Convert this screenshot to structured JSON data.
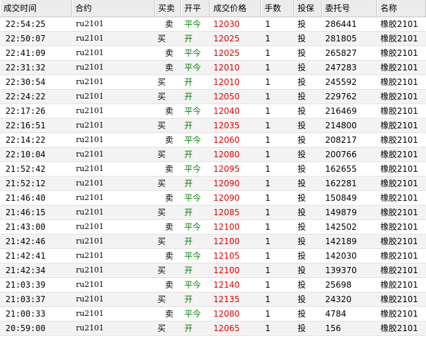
{
  "columns": {
    "time": "成交时间",
    "contract": "合约",
    "direction": "买卖",
    "open_close": "开平",
    "price": "成交价格",
    "quantity": "手数",
    "hedge": "投保",
    "order_no": "委托号",
    "name": "名称"
  },
  "trades": [
    {
      "time": "22:54:25",
      "contract": "ru2101",
      "direction": "卖",
      "open_close": "平今",
      "price": "12030",
      "quantity": "1",
      "hedge": "投",
      "order_no": "286441",
      "name": "橡胶2101"
    },
    {
      "time": "22:50:07",
      "contract": "ru2101",
      "direction": "买",
      "open_close": "开",
      "price": "12025",
      "quantity": "1",
      "hedge": "投",
      "order_no": "281805",
      "name": "橡胶2101"
    },
    {
      "time": "22:41:09",
      "contract": "ru2101",
      "direction": "卖",
      "open_close": "平今",
      "price": "12025",
      "quantity": "1",
      "hedge": "投",
      "order_no": "265827",
      "name": "橡胶2101"
    },
    {
      "time": "22:31:32",
      "contract": "ru2101",
      "direction": "卖",
      "open_close": "平今",
      "price": "12010",
      "quantity": "1",
      "hedge": "投",
      "order_no": "247283",
      "name": "橡胶2101"
    },
    {
      "time": "22:30:54",
      "contract": "ru2101",
      "direction": "买",
      "open_close": "开",
      "price": "12010",
      "quantity": "1",
      "hedge": "投",
      "order_no": "245592",
      "name": "橡胶2101"
    },
    {
      "time": "22:24:22",
      "contract": "ru2101",
      "direction": "买",
      "open_close": "开",
      "price": "12050",
      "quantity": "1",
      "hedge": "投",
      "order_no": "229762",
      "name": "橡胶2101"
    },
    {
      "time": "22:17:26",
      "contract": "ru2101",
      "direction": "卖",
      "open_close": "平今",
      "price": "12040",
      "quantity": "1",
      "hedge": "投",
      "order_no": "216469",
      "name": "橡胶2101"
    },
    {
      "time": "22:16:51",
      "contract": "ru2101",
      "direction": "买",
      "open_close": "开",
      "price": "12035",
      "quantity": "1",
      "hedge": "投",
      "order_no": "214800",
      "name": "橡胶2101"
    },
    {
      "time": "22:14:22",
      "contract": "ru2101",
      "direction": "卖",
      "open_close": "平今",
      "price": "12060",
      "quantity": "1",
      "hedge": "投",
      "order_no": "208217",
      "name": "橡胶2101"
    },
    {
      "time": "22:10:04",
      "contract": "ru2101",
      "direction": "买",
      "open_close": "开",
      "price": "12080",
      "quantity": "1",
      "hedge": "投",
      "order_no": "200766",
      "name": "橡胶2101"
    },
    {
      "time": "21:52:42",
      "contract": "ru2101",
      "direction": "卖",
      "open_close": "平今",
      "price": "12095",
      "quantity": "1",
      "hedge": "投",
      "order_no": "162655",
      "name": "橡胶2101"
    },
    {
      "time": "21:52:12",
      "contract": "ru2101",
      "direction": "买",
      "open_close": "开",
      "price": "12090",
      "quantity": "1",
      "hedge": "投",
      "order_no": "162281",
      "name": "橡胶2101"
    },
    {
      "time": "21:46:40",
      "contract": "ru2101",
      "direction": "卖",
      "open_close": "平今",
      "price": "12090",
      "quantity": "1",
      "hedge": "投",
      "order_no": "150849",
      "name": "橡胶2101"
    },
    {
      "time": "21:46:15",
      "contract": "ru2101",
      "direction": "买",
      "open_close": "开",
      "price": "12085",
      "quantity": "1",
      "hedge": "投",
      "order_no": "149879",
      "name": "橡胶2101"
    },
    {
      "time": "21:43:00",
      "contract": "ru2101",
      "direction": "卖",
      "open_close": "平今",
      "price": "12100",
      "quantity": "1",
      "hedge": "投",
      "order_no": "142502",
      "name": "橡胶2101"
    },
    {
      "time": "21:42:46",
      "contract": "ru2101",
      "direction": "买",
      "open_close": "开",
      "price": "12100",
      "quantity": "1",
      "hedge": "投",
      "order_no": "142189",
      "name": "橡胶2101"
    },
    {
      "time": "21:42:41",
      "contract": "ru2101",
      "direction": "卖",
      "open_close": "平今",
      "price": "12105",
      "quantity": "1",
      "hedge": "投",
      "order_no": "142030",
      "name": "橡胶2101"
    },
    {
      "time": "21:42:34",
      "contract": "ru2101",
      "direction": "买",
      "open_close": "开",
      "price": "12100",
      "quantity": "1",
      "hedge": "投",
      "order_no": "139370",
      "name": "橡胶2101"
    },
    {
      "time": "21:03:39",
      "contract": "ru2101",
      "direction": "卖",
      "open_close": "平今",
      "price": "12140",
      "quantity": "1",
      "hedge": "投",
      "order_no": "25698",
      "name": "橡胶2101"
    },
    {
      "time": "21:03:37",
      "contract": "ru2101",
      "direction": "买",
      "open_close": "开",
      "price": "12135",
      "quantity": "1",
      "hedge": "投",
      "order_no": "24320",
      "name": "橡胶2101"
    },
    {
      "time": "21:00:33",
      "contract": "ru2101",
      "direction": "卖",
      "open_close": "平今",
      "price": "12080",
      "quantity": "1",
      "hedge": "投",
      "order_no": "4784",
      "name": "橡胶2101"
    },
    {
      "time": "20:59:00",
      "contract": "ru2101",
      "direction": "买",
      "open_close": "开",
      "price": "12065",
      "quantity": "1",
      "hedge": "投",
      "order_no": "156",
      "name": "橡胶2101"
    }
  ]
}
